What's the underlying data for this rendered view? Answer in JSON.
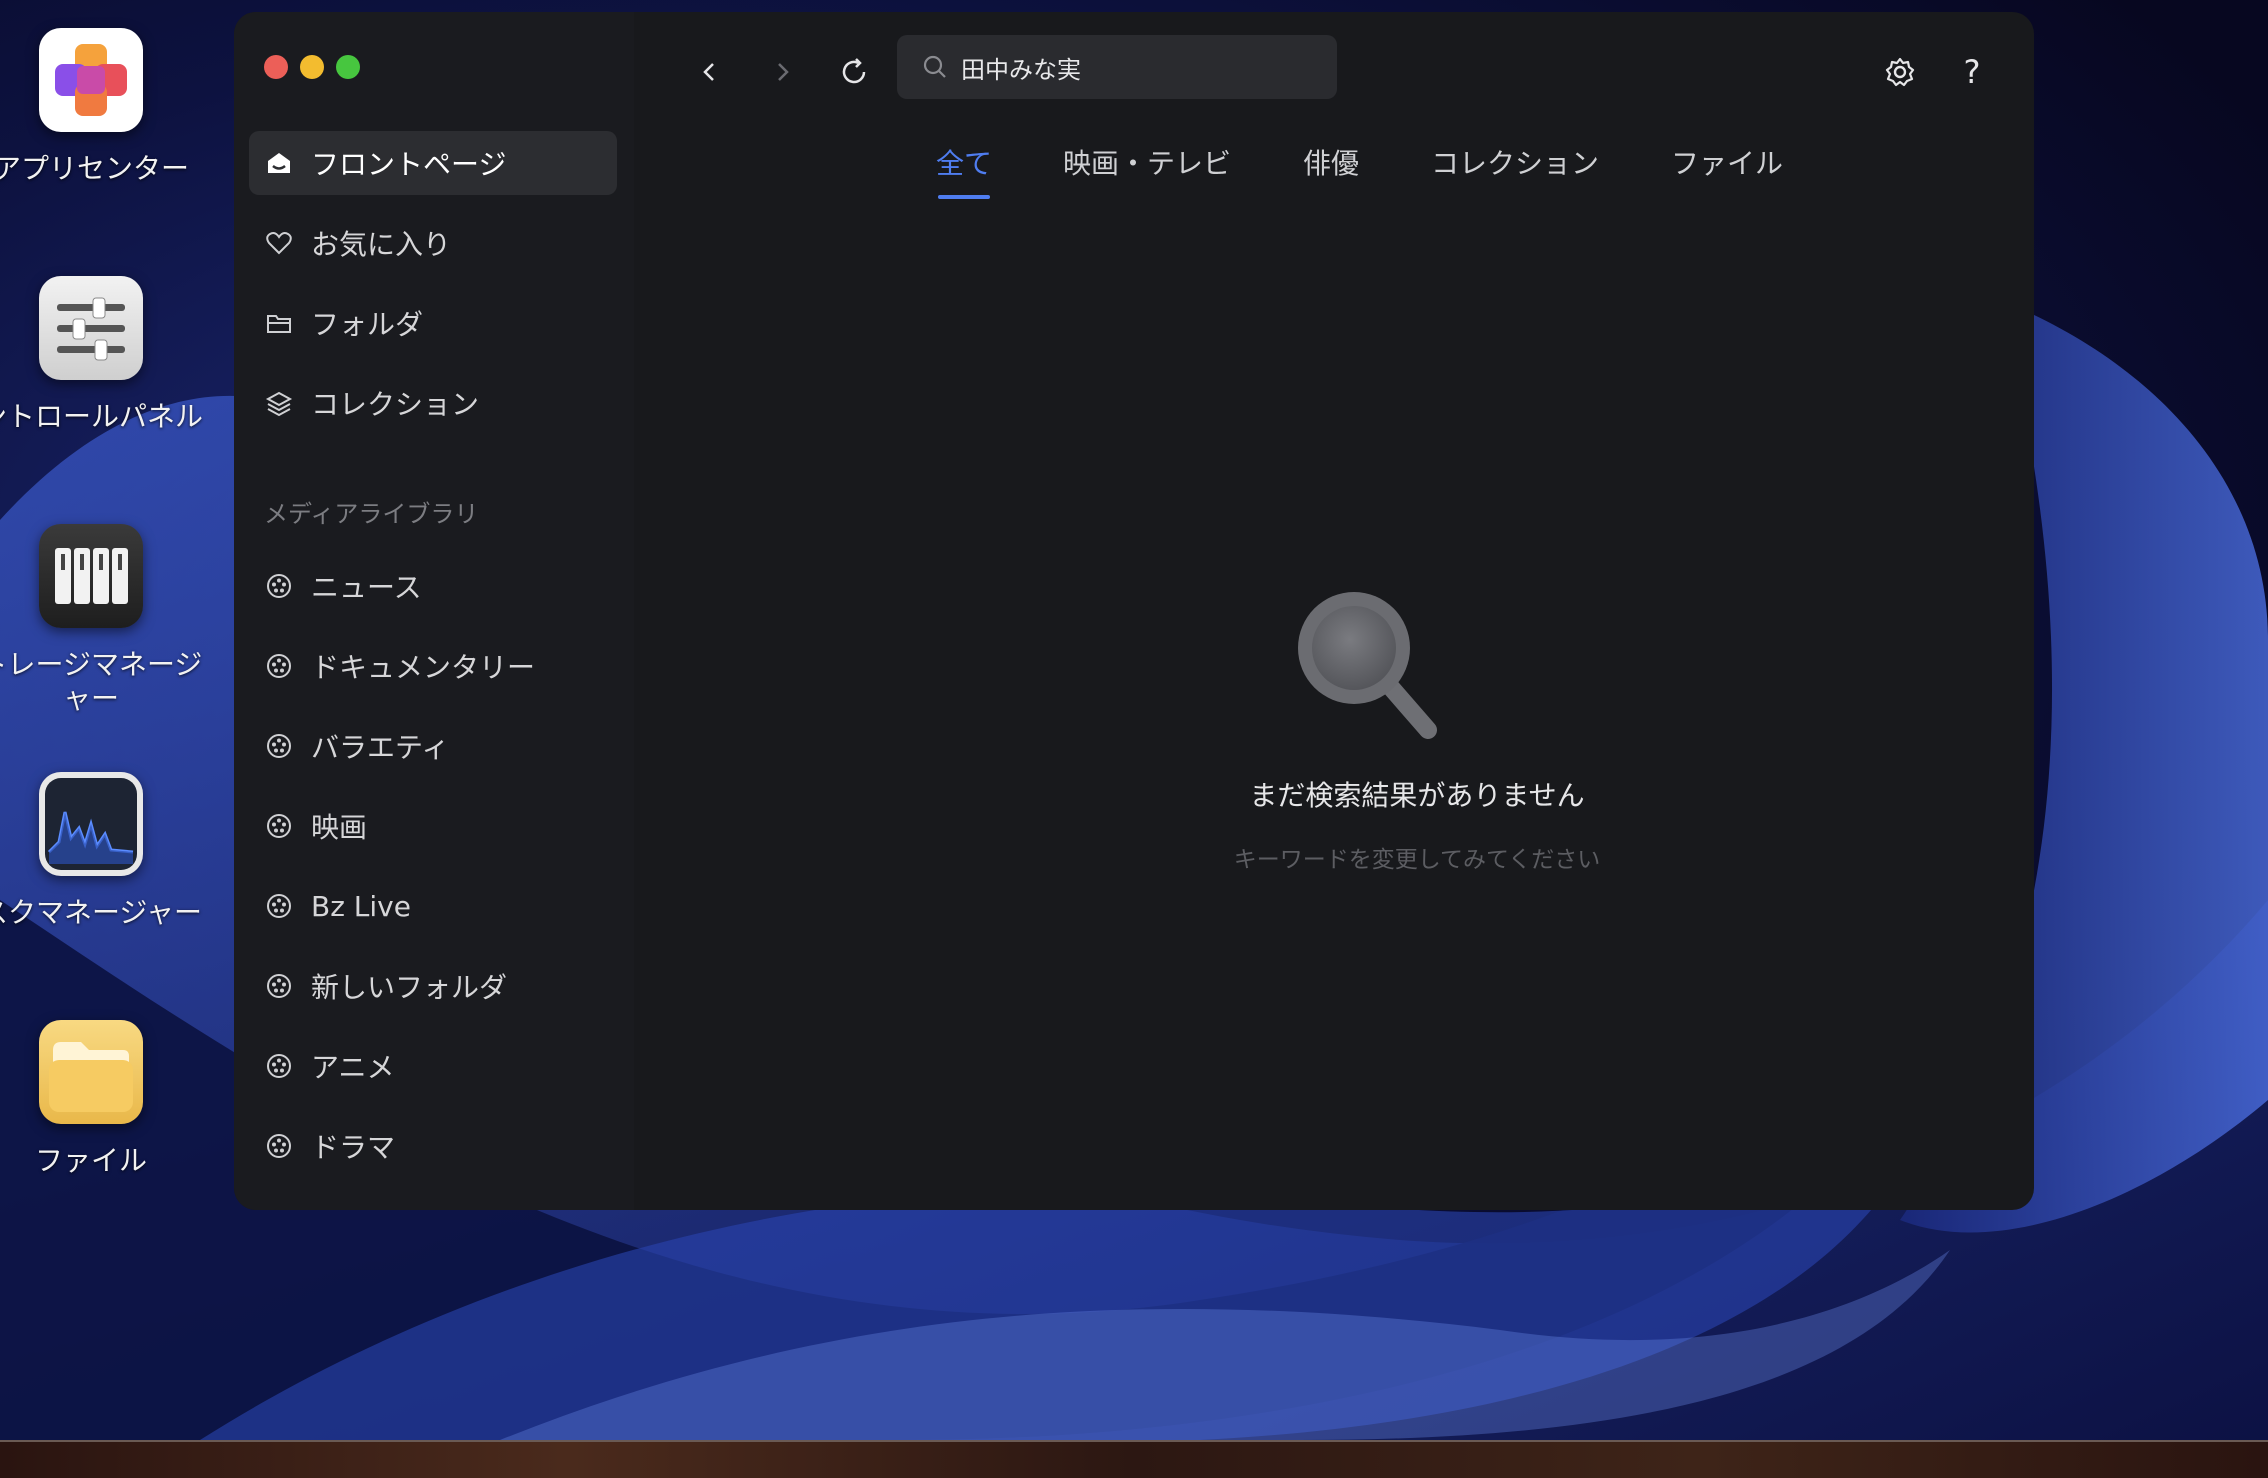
{
  "desktop": {
    "icons": [
      {
        "label": "アプリセンター",
        "icon": "app-center-icon"
      },
      {
        "label": "ントロールパネル",
        "icon": "control-panel-icon"
      },
      {
        "label": "トレージマネージ",
        "label2": "ャー",
        "icon": "storage-manager-icon"
      },
      {
        "label": "スクマネージャー",
        "icon": "task-manager-icon"
      },
      {
        "label": "ファイル",
        "icon": "files-icon"
      }
    ]
  },
  "window": {
    "search": {
      "value": "田中みな実",
      "icon": "search-icon"
    },
    "toolbar": {
      "back_icon": "chevron-left-icon",
      "forward_icon": "chevron-right-icon",
      "refresh_icon": "refresh-icon",
      "settings_icon": "gear-icon",
      "help_label": "?"
    },
    "sidebar": {
      "items": [
        {
          "label": "フロントページ",
          "icon": "home-icon",
          "active": true
        },
        {
          "label": "お気に入り",
          "icon": "heart-icon"
        },
        {
          "label": "フォルダ",
          "icon": "folder-icon"
        },
        {
          "label": "コレクション",
          "icon": "layers-icon"
        }
      ],
      "section_title": "メディアライブラリ",
      "library": [
        {
          "label": "ニュース",
          "icon": "film-reel-icon"
        },
        {
          "label": "ドキュメンタリー",
          "icon": "film-reel-icon"
        },
        {
          "label": "バラエティ",
          "icon": "film-reel-icon"
        },
        {
          "label": "映画",
          "icon": "film-reel-icon"
        },
        {
          "label": "Bz Live",
          "icon": "film-reel-icon"
        },
        {
          "label": "新しいフォルダ",
          "icon": "film-reel-icon"
        },
        {
          "label": "アニメ",
          "icon": "film-reel-icon"
        },
        {
          "label": "ドラマ",
          "icon": "film-reel-icon"
        }
      ]
    },
    "tabs": [
      {
        "label": "全て",
        "active": true
      },
      {
        "label": "映画・テレビ"
      },
      {
        "label": "俳優"
      },
      {
        "label": "コレクション"
      },
      {
        "label": "ファイル"
      }
    ],
    "empty_state": {
      "icon": "magnifier-icon",
      "title": "まだ検索結果がありません",
      "subtitle": "キーワードを変更してみてください"
    }
  },
  "colors": {
    "accent": "#4f7df0",
    "close": "#ec5f58",
    "minimize": "#f3bc2f",
    "zoom": "#47c63f"
  }
}
